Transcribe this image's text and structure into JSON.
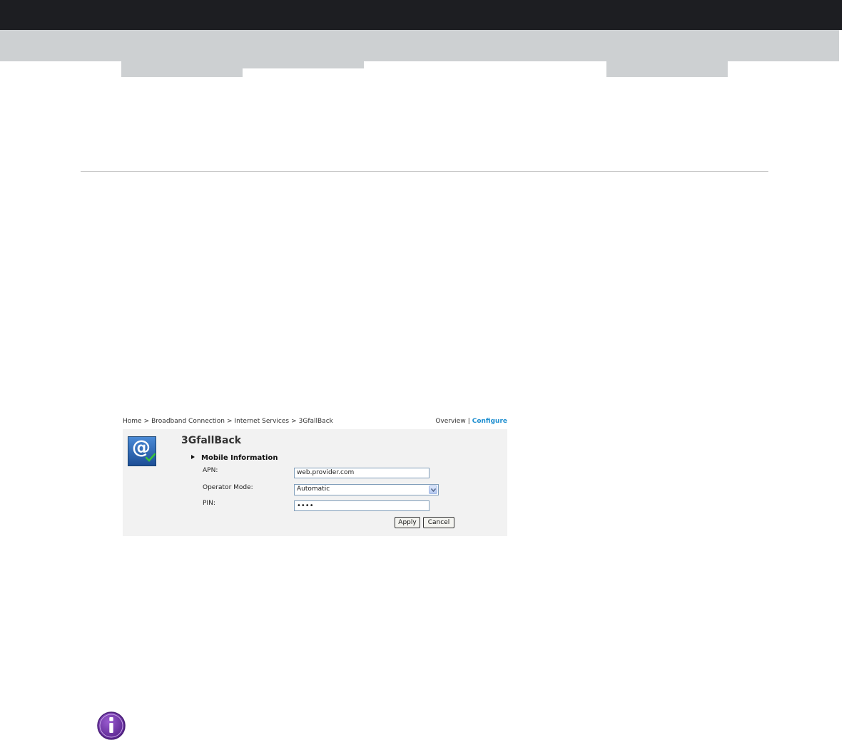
{
  "breadcrumb": [
    "Home",
    "Broadband Connection",
    "Internet Services",
    "3GfallBack"
  ],
  "breadcrumb_separator": ">",
  "view_links": {
    "overview": "Overview",
    "separator": "|",
    "configure": "Configure"
  },
  "page": {
    "title": "3GfallBack",
    "icon": "internet-at-check-icon"
  },
  "section": {
    "title": "Mobile Information"
  },
  "fields": {
    "apn": {
      "label": "APN:",
      "value": "web.provider.com"
    },
    "operator_mode": {
      "label": "Operator Mode:",
      "value": "Automatic"
    },
    "pin": {
      "label": "PIN:",
      "value": "••••"
    }
  },
  "buttons": {
    "apply": "Apply",
    "cancel": "Cancel"
  },
  "note_icon": "info-icon",
  "colors": {
    "top_bar": "#1d1e22",
    "band": "#cdd0d2",
    "link_active": "#1f8fd0",
    "info_purple": "#6b2fa0"
  }
}
